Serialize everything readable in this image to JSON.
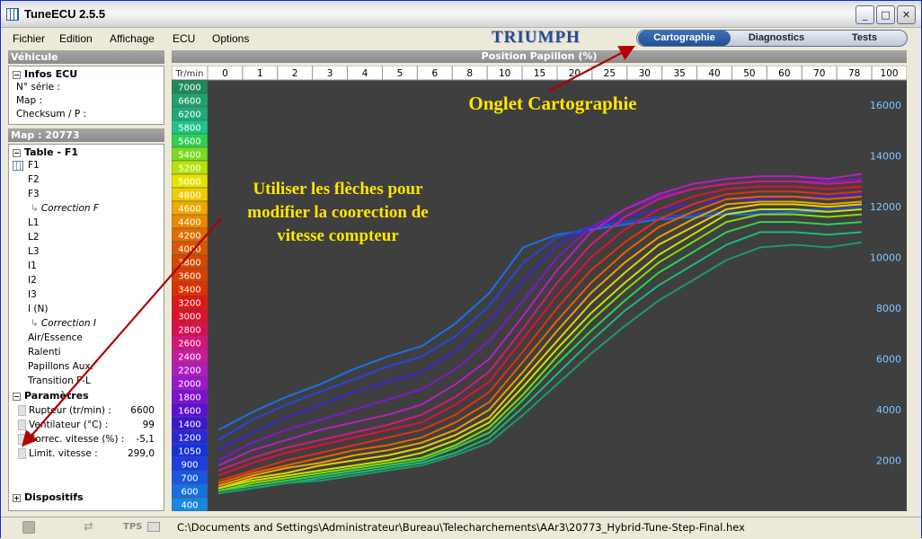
{
  "window": {
    "title": "TuneECU 2.5.5",
    "min_glyph": "_",
    "max_glyph": "□",
    "close_glyph": "✕"
  },
  "menu": [
    "Fichier",
    "Edition",
    "Affichage",
    "ECU",
    "Options"
  ],
  "brand_logo": "TRIUMPH",
  "tabs": [
    {
      "label": "Cartographie",
      "active": true
    },
    {
      "label": "Diagnostics",
      "active": false
    },
    {
      "label": "Tests",
      "active": false
    }
  ],
  "left": {
    "vehicle_header": "Véhicule",
    "infos": {
      "title": "Infos ECU",
      "lines": [
        "N° série :",
        "Map :",
        "Checksum / P :"
      ]
    },
    "map_header": "Map : 20773",
    "table": {
      "title": "Table - F1",
      "items": [
        {
          "label": "F1",
          "sub": false
        },
        {
          "label": "F2",
          "sub": false
        },
        {
          "label": "F3",
          "sub": false
        },
        {
          "label": "Correction F",
          "sub": true
        },
        {
          "label": "L1",
          "sub": false
        },
        {
          "label": "L2",
          "sub": false
        },
        {
          "label": "L3",
          "sub": false
        },
        {
          "label": "I1",
          "sub": false
        },
        {
          "label": "I2",
          "sub": false
        },
        {
          "label": "I3",
          "sub": false
        },
        {
          "label": "I (N)",
          "sub": false
        },
        {
          "label": "Correction I",
          "sub": true
        },
        {
          "label": "Air/Essence",
          "sub": false
        },
        {
          "label": "Ralenti",
          "sub": false
        },
        {
          "label": "Papillons Aux.",
          "sub": false
        },
        {
          "label": "Transition F-L",
          "sub": false
        }
      ]
    },
    "params": {
      "title": "Paramètres",
      "items": [
        {
          "label": "Rupteur (tr/min) :",
          "value": "6600"
        },
        {
          "label": "Ventilateur (°C) :",
          "value": "99"
        },
        {
          "label": "Correc. vitesse (%) :",
          "value": "-5,1"
        },
        {
          "label": "Limit. vitesse :",
          "value": "299,0"
        }
      ]
    },
    "devices": {
      "title": "Dispositifs"
    }
  },
  "grid": {
    "x_header": "Position Papillon (%)",
    "corner": "Tr/min",
    "x_ticks": [
      "0",
      "1",
      "2",
      "3",
      "4",
      "5",
      "6",
      "8",
      "10",
      "15",
      "20",
      "25",
      "30",
      "35",
      "40",
      "50",
      "60",
      "70",
      "78",
      "100"
    ],
    "rpm": [
      "7000",
      "6600",
      "6200",
      "5800",
      "5600",
      "5400",
      "5200",
      "5000",
      "4800",
      "4600",
      "4400",
      "4200",
      "4000",
      "3800",
      "3600",
      "3400",
      "3200",
      "3000",
      "2800",
      "2600",
      "2400",
      "2200",
      "2000",
      "1800",
      "1600",
      "1400",
      "1200",
      "1050",
      "900",
      "700",
      "600",
      "400"
    ],
    "rpm_colors": [
      "#1e8a58",
      "#22a06a",
      "#1faa7a",
      "#1ec48a",
      "#30d050",
      "#78dc20",
      "#b8e20a",
      "#e6e400",
      "#f0cc00",
      "#eeaa00",
      "#e88a00",
      "#e06e00",
      "#dc5600",
      "#d44800",
      "#d84000",
      "#e03000",
      "#dc1a18",
      "#e0102c",
      "#dc0e50",
      "#d81478",
      "#c81ca0",
      "#b01cc0",
      "#9a18cc",
      "#7e10d0",
      "#5c10d0",
      "#3c18d0",
      "#2828d8",
      "#1830e0",
      "#1a3ee0",
      "#1a58e0",
      "#1870e0",
      "#1a86e0"
    ]
  },
  "chart_data": {
    "type": "line",
    "x": [
      0,
      1,
      2,
      3,
      4,
      5,
      6,
      8,
      10,
      15,
      20,
      25,
      30,
      35,
      40,
      50,
      60,
      70,
      78,
      100
    ],
    "ylim": [
      0,
      17000
    ],
    "y_ticks": [
      2000,
      4000,
      6000,
      8000,
      10000,
      12000,
      14000,
      16000
    ],
    "series": [
      {
        "values": [
          3200,
          3900,
          4500,
          5000,
          5600,
          6100,
          6500,
          7400,
          8600,
          10400,
          10900,
          11100,
          11300,
          11500,
          11600,
          11700,
          11700,
          11800,
          11800,
          11900
        ]
      },
      {
        "values": [
          2800,
          3600,
          4200,
          4700,
          5200,
          5700,
          6100,
          6900,
          8100,
          9800,
          10800,
          11200,
          11400,
          11600,
          11700,
          11800,
          11800,
          11900,
          11900,
          12000
        ]
      },
      {
        "values": [
          2400,
          3100,
          3700,
          4200,
          4700,
          5100,
          5500,
          6300,
          7500,
          9100,
          10500,
          11200,
          11600,
          11900,
          12100,
          12300,
          12300,
          12400,
          12400,
          12500
        ]
      },
      {
        "values": [
          2000,
          2700,
          3200,
          3600,
          4000,
          4400,
          4800,
          5600,
          6700,
          8300,
          10000,
          11200,
          11900,
          12400,
          12700,
          12900,
          13000,
          13000,
          13000,
          13100
        ]
      },
      {
        "values": [
          1800,
          2400,
          2800,
          3200,
          3500,
          3800,
          4200,
          5000,
          6000,
          7700,
          9500,
          11000,
          11900,
          12500,
          12900,
          13100,
          13200,
          13200,
          13100,
          13300
        ]
      },
      {
        "values": [
          1600,
          2100,
          2500,
          2800,
          3100,
          3400,
          3800,
          4500,
          5500,
          7200,
          9000,
          10500,
          11600,
          12300,
          12700,
          12900,
          13000,
          13000,
          12900,
          13000
        ]
      },
      {
        "values": [
          1400,
          1900,
          2300,
          2600,
          2900,
          3200,
          3500,
          4200,
          5100,
          6800,
          8500,
          10000,
          11100,
          11900,
          12400,
          12700,
          12800,
          12800,
          12700,
          12800
        ]
      },
      {
        "values": [
          1200,
          1600,
          2000,
          2300,
          2600,
          2900,
          3200,
          3800,
          4700,
          6300,
          8000,
          9500,
          10600,
          11500,
          12100,
          12500,
          12600,
          12600,
          12500,
          12600
        ]
      },
      {
        "values": [
          1100,
          1500,
          1800,
          2100,
          2400,
          2600,
          2900,
          3500,
          4300,
          5900,
          7500,
          9000,
          10200,
          11200,
          11800,
          12300,
          12400,
          12400,
          12300,
          12400
        ]
      },
      {
        "values": [
          1000,
          1400,
          1700,
          1900,
          2200,
          2400,
          2700,
          3200,
          4000,
          5500,
          7100,
          8600,
          9800,
          10800,
          11500,
          12100,
          12200,
          12200,
          12100,
          12200
        ]
      },
      {
        "values": [
          900,
          1300,
          1500,
          1800,
          2000,
          2200,
          2500,
          3000,
          3700,
          5200,
          6700,
          8200,
          9400,
          10500,
          11200,
          11900,
          12100,
          12100,
          12000,
          12100
        ]
      },
      {
        "values": [
          900,
          1200,
          1400,
          1600,
          1800,
          2000,
          2300,
          2800,
          3500,
          4900,
          6400,
          7800,
          9000,
          10100,
          10900,
          11700,
          11900,
          11900,
          11800,
          11900
        ]
      },
      {
        "values": [
          800,
          1100,
          1300,
          1500,
          1700,
          1900,
          2100,
          2600,
          3300,
          4600,
          6100,
          7500,
          8700,
          9800,
          10600,
          11400,
          11700,
          11700,
          11600,
          11700
        ]
      },
      {
        "values": [
          800,
          1000,
          1200,
          1400,
          1600,
          1800,
          2000,
          2500,
          3100,
          4400,
          5800,
          7100,
          8300,
          9400,
          10200,
          11000,
          11400,
          11400,
          11300,
          11400
        ]
      },
      {
        "values": [
          700,
          900,
          1100,
          1300,
          1500,
          1700,
          1900,
          2300,
          2900,
          4100,
          5400,
          6700,
          7900,
          8900,
          9700,
          10500,
          11000,
          11000,
          10900,
          11000
        ]
      },
      {
        "values": [
          700,
          900,
          1100,
          1200,
          1400,
          1600,
          1800,
          2200,
          2700,
          3800,
          5000,
          6200,
          7300,
          8300,
          9100,
          9900,
          10400,
          10500,
          10400,
          10600
        ]
      }
    ]
  },
  "annotations": {
    "tab_note": "Onglet Cartographie",
    "arrows_note": [
      "Utiliser les flèches pour",
      "modifier la coorection de",
      "vitesse compteur"
    ]
  },
  "status": {
    "tps_label": "TPS",
    "path": "C:\\Documents and Settings\\Administrateur\\Bureau\\Telecharchements\\AAr3\\20773_Hybrid-Tune-Step-Final.hex"
  },
  "colors": {
    "accent": "#244f94",
    "chart_bg": "#3f3f3f",
    "axis_text": "#7fc8ff",
    "annotation": "#ffe600",
    "arrow": "#b00000"
  }
}
